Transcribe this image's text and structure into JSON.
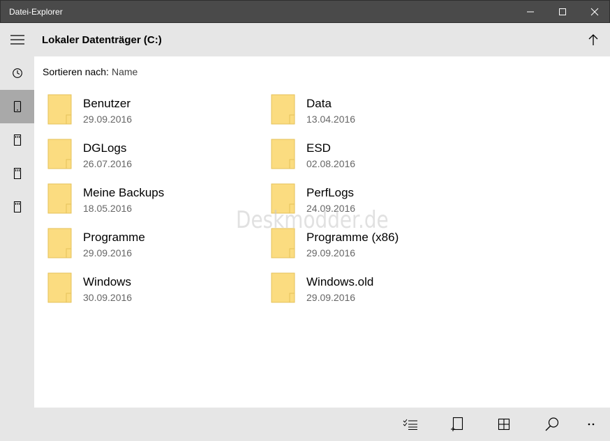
{
  "window": {
    "title": "Datei-Explorer"
  },
  "header": {
    "location": "Lokaler Datenträger (C:)"
  },
  "sort": {
    "label": "Sortieren nach:",
    "value": "Name"
  },
  "sidebar": {
    "items": [
      {
        "icon": "hamburger-menu-icon"
      },
      {
        "icon": "recent-clock-icon"
      },
      {
        "icon": "phone-device-icon",
        "active": true
      },
      {
        "icon": "storage-card-icon"
      },
      {
        "icon": "storage-card-icon"
      },
      {
        "icon": "storage-card-icon"
      }
    ]
  },
  "folders": [
    {
      "name": "Benutzer",
      "date": "29.09.2016"
    },
    {
      "name": "Data",
      "date": "13.04.2016"
    },
    {
      "name": "DGLogs",
      "date": "26.07.2016"
    },
    {
      "name": "ESD",
      "date": "02.08.2016"
    },
    {
      "name": "Meine Backups",
      "date": "18.05.2016"
    },
    {
      "name": "PerfLogs",
      "date": "24.09.2016"
    },
    {
      "name": "Programme",
      "date": "29.09.2016"
    },
    {
      "name": "Programme (x86)",
      "date": "29.09.2016"
    },
    {
      "name": "Windows",
      "date": "30.09.2016"
    },
    {
      "name": "Windows.old",
      "date": "29.09.2016"
    }
  ],
  "watermark": "Deskmodder.de",
  "commandbar": {
    "items": [
      "select-list-icon",
      "new-item-icon",
      "grid-view-icon",
      "search-icon",
      "more-icon"
    ]
  },
  "colors": {
    "titlebar": "#4a4a4a",
    "chrome": "#e6e6e6",
    "sidebar_active": "#a9a9a9",
    "folder": "#fbdc80",
    "date_text": "#666666"
  }
}
